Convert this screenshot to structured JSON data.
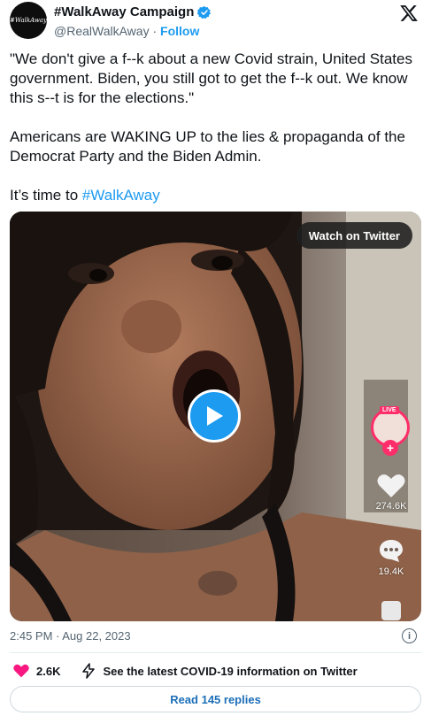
{
  "author": {
    "avatar_text": "#WalkAway",
    "name": "#WalkAway Campaign",
    "handle": "@RealWalkAway",
    "separator": " · ",
    "follow_label": "Follow"
  },
  "tweet": {
    "paragraph1": "\"We don't give a f--k about a new Covid strain, United States government. Biden, you still got to get the f--k out. We know this s--t is for the elections.\"",
    "paragraph2": "Americans are WAKING UP to the lies & propaganda of the Democrat Party and the Biden Admin.",
    "paragraph3_prefix": "It’s time to ",
    "hashtag": "#WalkAway"
  },
  "video": {
    "watch_label": "Watch on Twitter",
    "live_label": "LIVE",
    "likes_overlay": "274.6K",
    "comments_overlay": "19.4K"
  },
  "meta": {
    "timestamp": "2:45 PM · Aug 22, 2023"
  },
  "actions": {
    "like_count": "2.6K",
    "covid_info": "See the latest COVID-19 information on Twitter"
  },
  "replies": {
    "label": "Read 145 replies"
  },
  "colors": {
    "accent": "#1d9bf0",
    "like": "#f91880",
    "text": "#0f1419",
    "muted": "#536471"
  }
}
